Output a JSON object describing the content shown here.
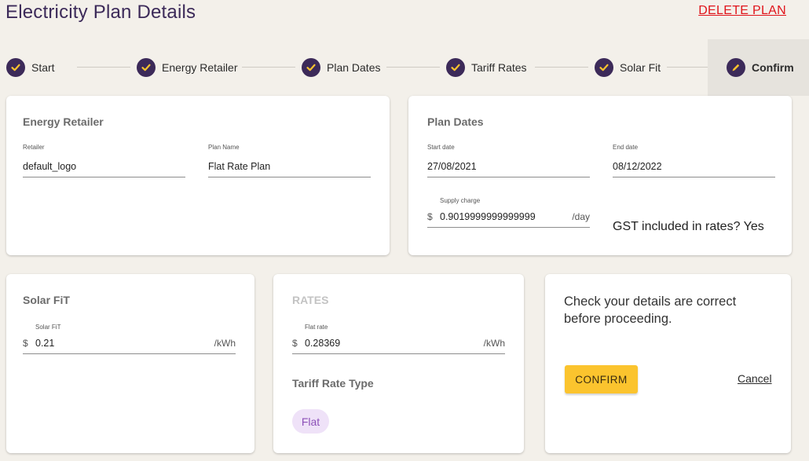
{
  "page": {
    "title": "Electricity Plan Details",
    "delete_label": "DELETE PLAN"
  },
  "stepper": {
    "steps": [
      {
        "label": "Start",
        "state": "complete",
        "icon": "check-icon"
      },
      {
        "label": "Energy Retailer",
        "state": "complete",
        "icon": "check-icon"
      },
      {
        "label": "Plan Dates",
        "state": "complete",
        "icon": "check-icon"
      },
      {
        "label": "Tariff Rates",
        "state": "complete",
        "icon": "check-icon"
      },
      {
        "label": "Solar Fit",
        "state": "complete",
        "icon": "check-icon"
      },
      {
        "label": "Confirm",
        "state": "active",
        "icon": "pencil-icon"
      }
    ]
  },
  "energy_retailer": {
    "title": "Energy Retailer",
    "retailer_label": "Retailer",
    "retailer_value": "default_logo",
    "plan_name_label": "Plan Name",
    "plan_name_value": "Flat Rate Plan"
  },
  "plan_dates": {
    "title": "Plan Dates",
    "start_label": "Start date",
    "start_value": "27/08/2021",
    "end_label": "End date",
    "end_value": "08/12/2022",
    "supply_label": "Supply charge",
    "supply_prefix": "$",
    "supply_value": "0.9019999999999999",
    "supply_suffix": "/day",
    "gst_text": "GST included in rates? Yes"
  },
  "solar_fit": {
    "title": "Solar FiT",
    "field_label": "Solar FiT",
    "prefix": "$",
    "value": "0.21",
    "suffix": "/kWh"
  },
  "rates": {
    "title": "RATES",
    "field_label": "Flat rate",
    "prefix": "$",
    "value": "0.28369",
    "suffix": "/kWh",
    "tariff_type_title": "Tariff Rate Type",
    "tariff_type_chip": "Flat"
  },
  "confirm": {
    "message": "Check your details are correct before proceeding.",
    "confirm_label": "CONFIRM",
    "cancel_label": "Cancel"
  },
  "colors": {
    "primary": "#3c2a59",
    "check": "#fbc42e",
    "danger": "#e0141b",
    "button": "#fbc42e",
    "chip_bg": "#efe2f8",
    "chip_text": "#8d52b9",
    "background": "#f3f0ea"
  }
}
